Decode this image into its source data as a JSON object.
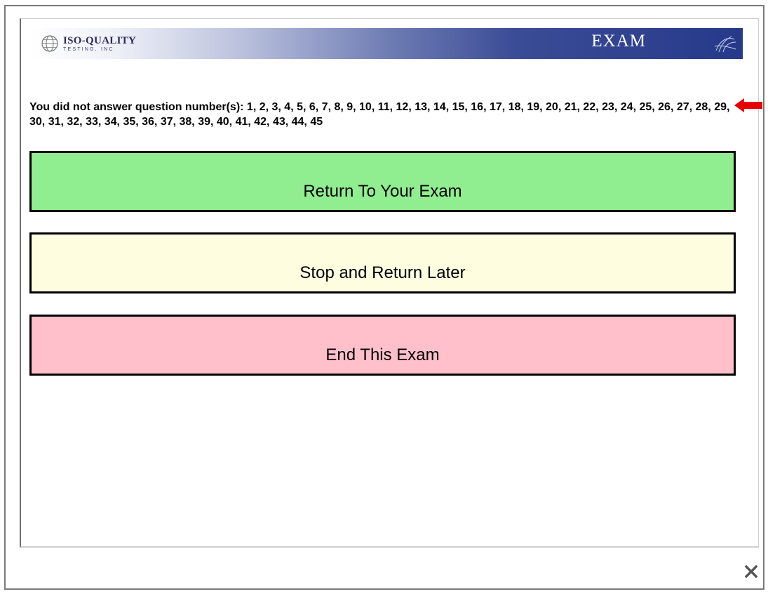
{
  "header": {
    "logo_name": "ISO-QUALITY",
    "logo_sub": "TESTING, INC",
    "title": "EXAM"
  },
  "notice": {
    "text": "You did not answer question number(s): 1, 2, 3, 4, 5, 6, 7, 8, 9, 10, 11, 12, 13, 14, 15, 16, 17, 18, 19, 20, 21, 22, 23, 24, 25, 26, 27, 28, 29, 30, 31, 32, 33, 34, 35, 36, 37, 38, 39, 40, 41, 42, 43, 44, 45"
  },
  "buttons": {
    "return_label": "Return To Your Exam",
    "stop_label": "Stop and Return Later",
    "end_label": "End This Exam"
  },
  "colors": {
    "return_bg": "#90ee90",
    "stop_bg": "#fffde0",
    "end_bg": "#ffc0cb",
    "arrow": "#e60000"
  },
  "icons": {
    "logo": "globe-icon",
    "banner_decoration": "globe-icon",
    "pointer": "arrow-left-icon",
    "close": "close-icon"
  }
}
